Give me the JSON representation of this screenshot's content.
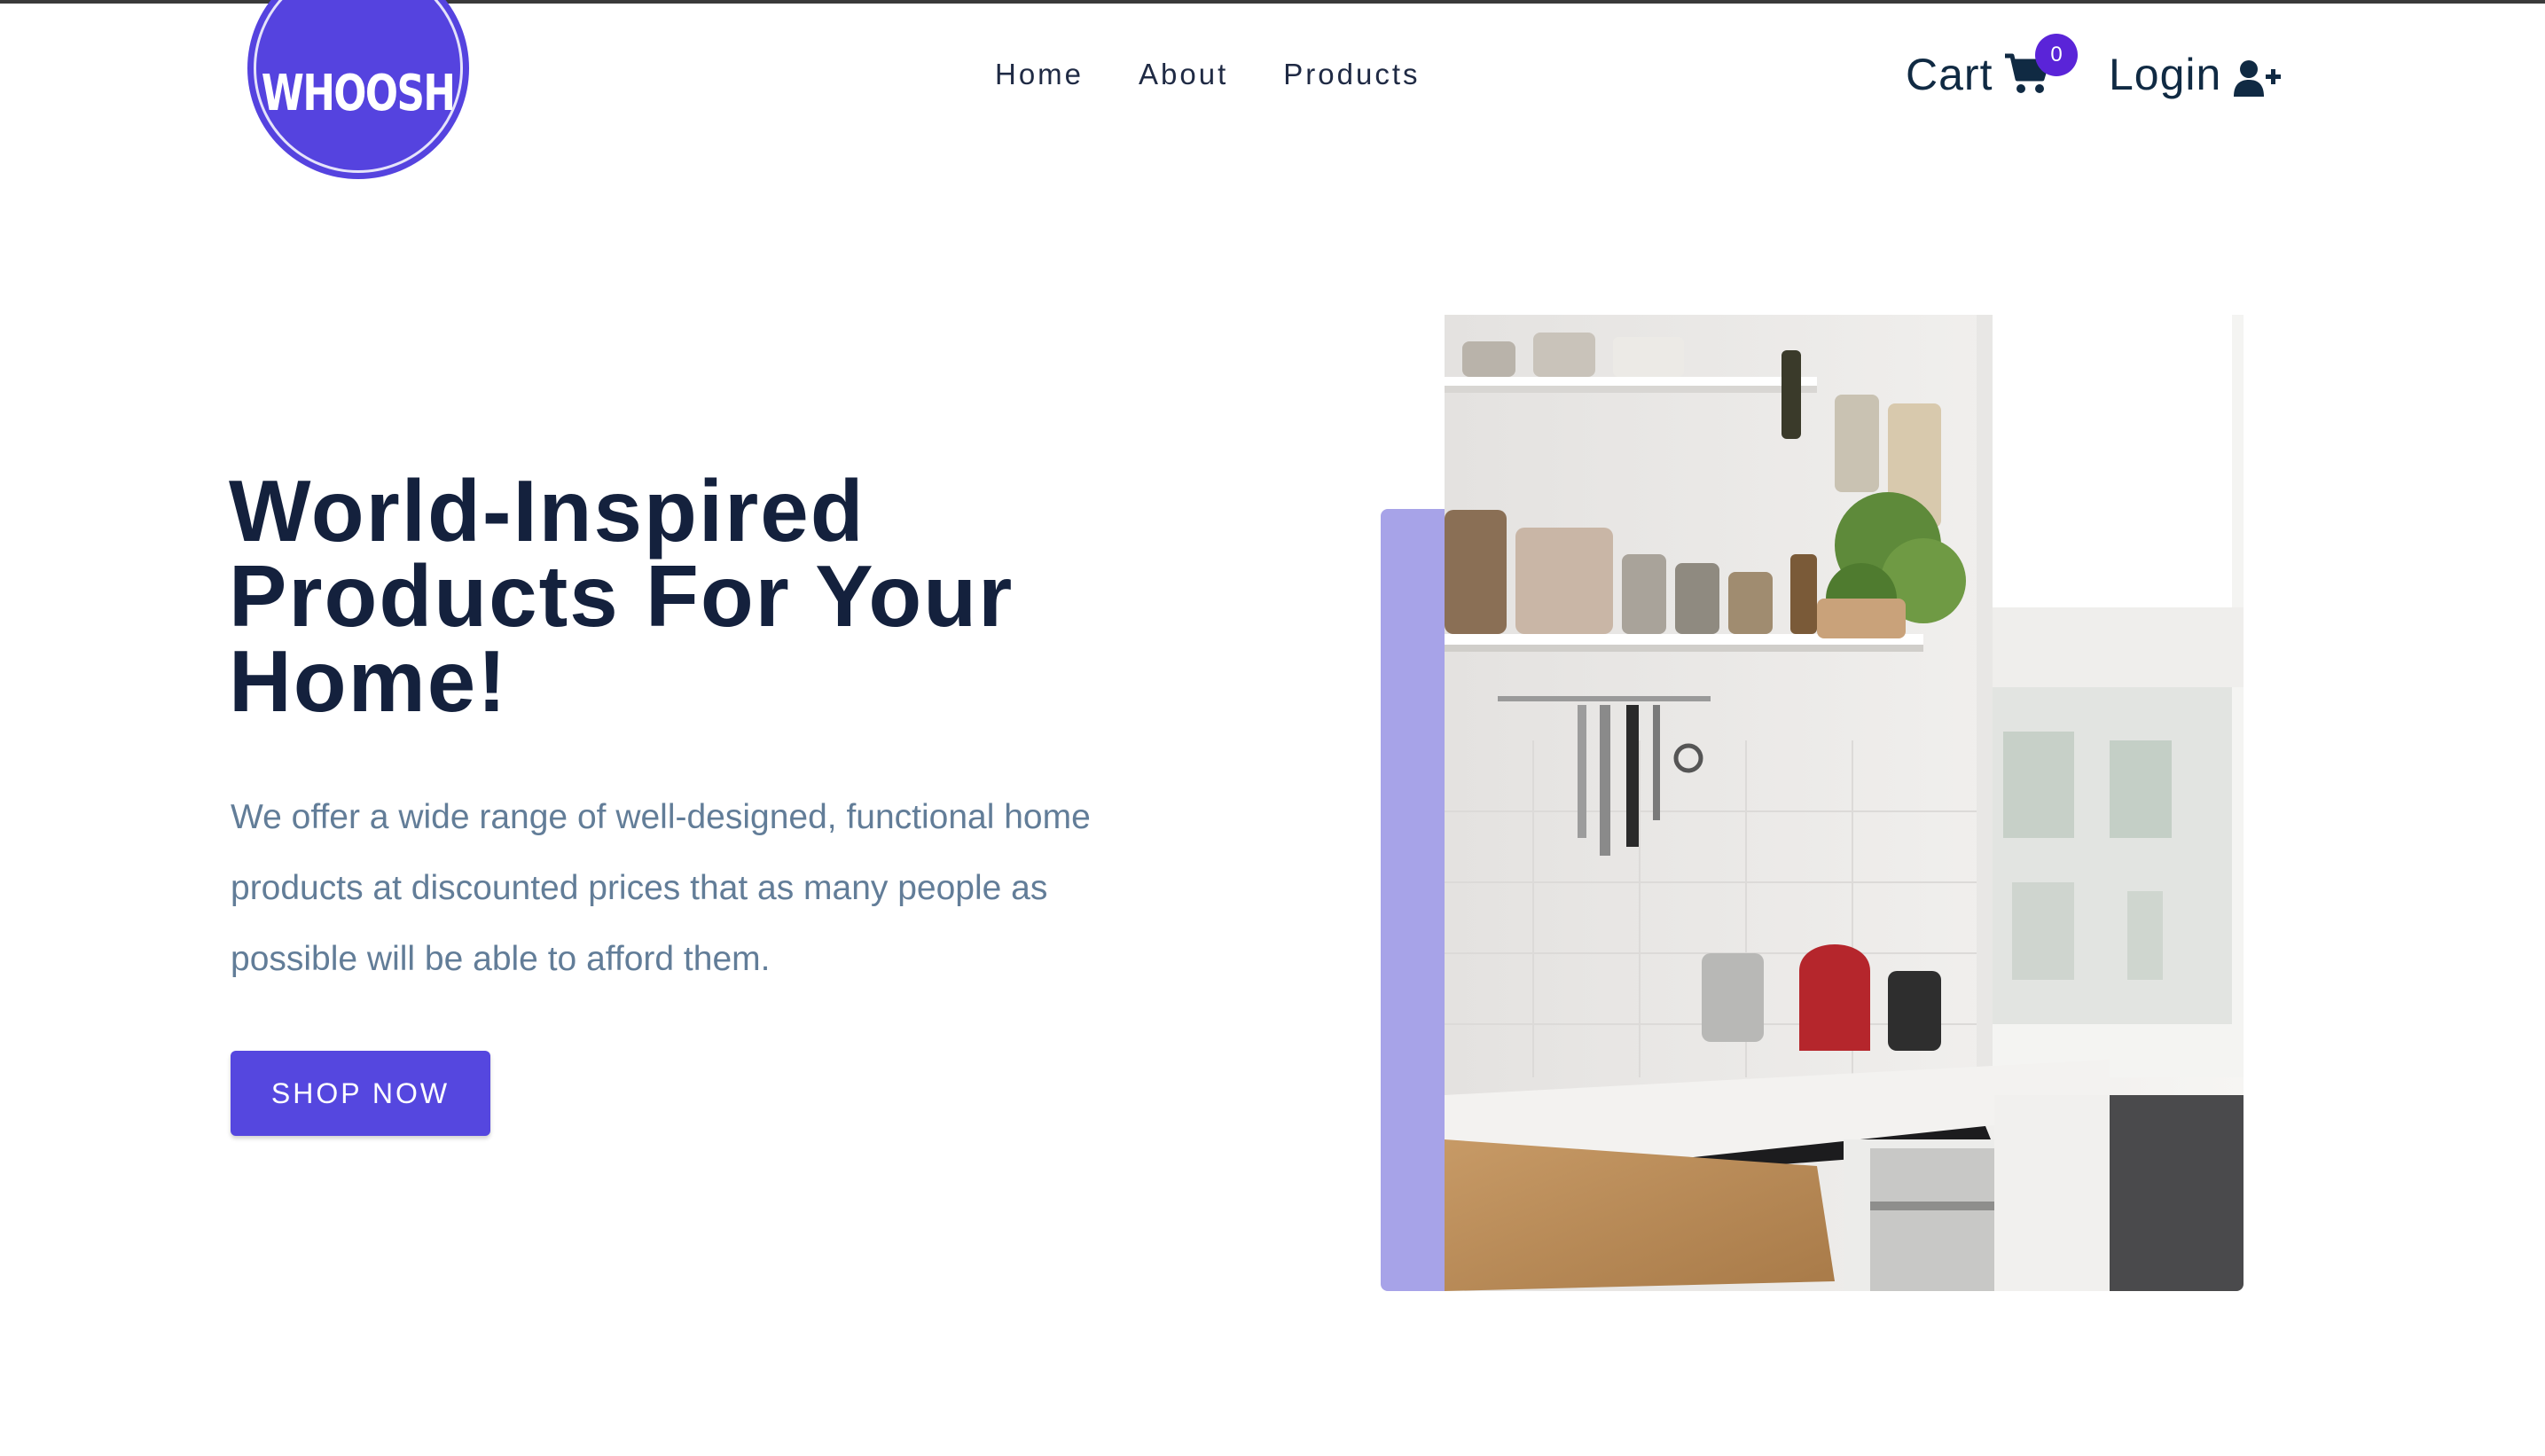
{
  "header": {
    "logo_text": "WHOOSH",
    "nav": [
      "Home",
      "About",
      "Products"
    ],
    "cart_label": "Cart",
    "cart_count": "0",
    "login_label": "Login"
  },
  "hero": {
    "title": "World-Inspired Products For Your Home!",
    "description": "We offer a wide range of well-designed, functional home products at discounted prices that as many people as possible will be able to afford them.",
    "cta_label": "SHOP NOW"
  },
  "icons": {
    "cart": "shopping-cart-icon",
    "login": "user-plus-icon"
  },
  "colors": {
    "brand": "#5547df",
    "accent": "#a7a3e8",
    "heading": "#14213d",
    "body_text": "#627d98",
    "badge": "#5a24d8"
  }
}
